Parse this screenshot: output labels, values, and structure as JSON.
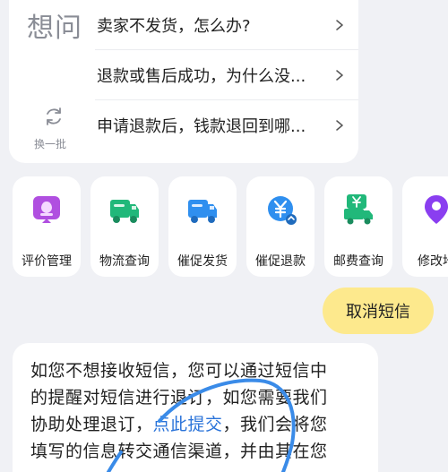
{
  "faq": {
    "title": "想问",
    "refresh_label": "换一批",
    "items": [
      {
        "label": "卖家不发货，怎么办?"
      },
      {
        "label": "退款或售后成功，为什么没..."
      },
      {
        "label": "申请退款后，钱款退回到哪..."
      }
    ]
  },
  "shortcuts": [
    {
      "label": "评价管理",
      "icon": "review-icon",
      "color": "#b04fe0"
    },
    {
      "label": "物流查询",
      "icon": "delivery-truck-icon",
      "color": "#21b87a"
    },
    {
      "label": "催促发货",
      "icon": "shipping-truck-icon",
      "color": "#2f8fef"
    },
    {
      "label": "催促退款",
      "icon": "refund-yen-icon",
      "color": "#2f8fef"
    },
    {
      "label": "邮费查询",
      "icon": "postage-truck-icon",
      "color": "#21b87a"
    },
    {
      "label": "修改地",
      "icon": "location-pin-icon",
      "color": "#8a3ef0"
    }
  ],
  "cancel_sms": {
    "label": "取消短信"
  },
  "message": {
    "line1": "如您不想接收短信，您可以通过短信中",
    "line2": "的提醒对短信进行退订，如您需要我们",
    "line3_before": "协助处理退订，",
    "link": "点此提交",
    "line3_after": "，我们会将您",
    "line4": "填写的信息转交通信渠道，并由其在您"
  },
  "colors": {
    "accent_yellow": "#fde98d",
    "link_blue": "#2a73d9",
    "scribble_blue": "#3a8be8"
  }
}
